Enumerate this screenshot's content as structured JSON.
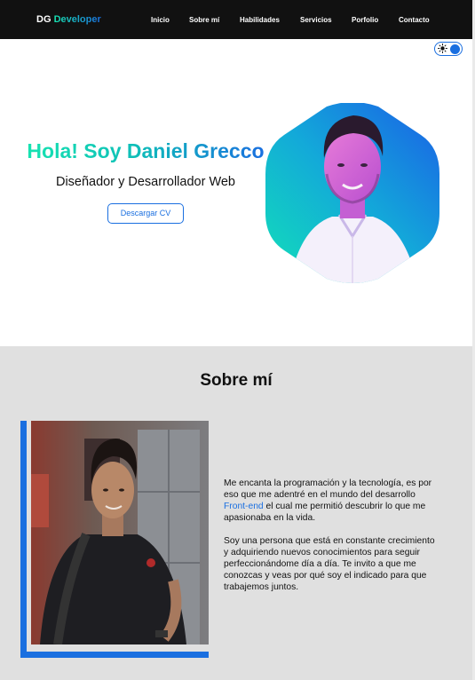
{
  "nav": {
    "logo_initials": "DG",
    "logo_word": "Developer",
    "links": [
      "Inicio",
      "Sobre mí",
      "Habilidades",
      "Servicios",
      "Porfolio",
      "Contacto"
    ]
  },
  "theme_toggle": {
    "icon": "sun-icon",
    "state": "on"
  },
  "hero": {
    "title": "Hola! Soy Daniel Grecco",
    "subtitle": "Diseñador y Desarrollador Web",
    "cv_button": "Descargar CV"
  },
  "about": {
    "title": "Sobre mí",
    "p1_before": "Me encanta la programación y la tecnología, es por eso que me adentré en el mundo del desarrollo ",
    "p1_highlight": "Front-end",
    "p1_after": " el cual me permitió descubrir lo que me apasionaba en la vida.",
    "p2": "Soy una persona que está en constante crecimiento y adquiriendo nuevos conocimientos para seguir perfeccionándome día a día. Te invito a que me conozcas y veas por qué soy el indicado para que trabajemos juntos."
  },
  "colors": {
    "accent": "#1a6fe0",
    "gradient_start": "#17e3b1",
    "nav_bg": "#111111",
    "section_bg": "#e0e0e0"
  }
}
